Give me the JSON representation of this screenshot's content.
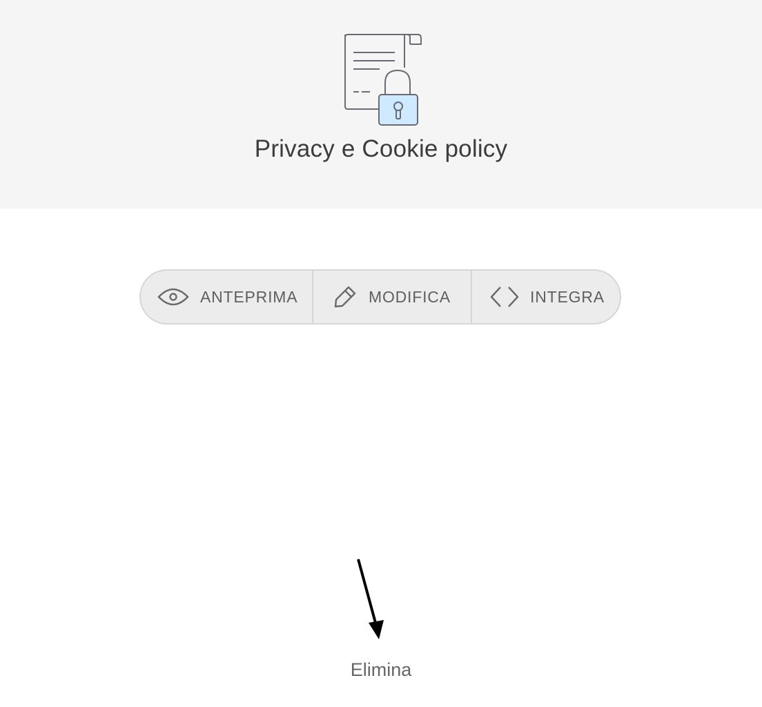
{
  "header": {
    "title": "Privacy e Cookie policy",
    "icon": "document-lock-icon",
    "background_color": "#f5f5f5"
  },
  "tabs": [
    {
      "label": "ANTEPRIMA",
      "icon": "eye-icon"
    },
    {
      "label": "MODIFICA",
      "icon": "pencil-icon"
    },
    {
      "label": "INTEGRA",
      "icon": "code-brackets-icon"
    }
  ],
  "footer": {
    "delete_label": "Elimina"
  },
  "annotation": {
    "icon": "arrow-icon",
    "color": "#000000"
  },
  "colors": {
    "lock_fill": "#cfe9ff",
    "icon_stroke": "#6a6a72",
    "segment_bg": "#ececec",
    "segment_border": "#d6d6d6"
  }
}
